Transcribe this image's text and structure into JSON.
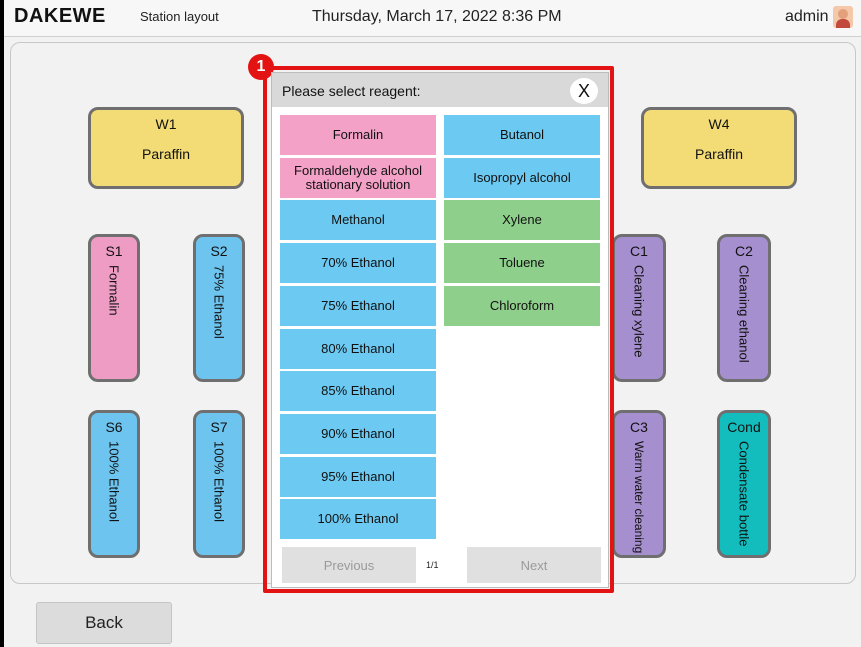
{
  "header": {
    "logo": "DAKEWE",
    "page_name": "Station layout",
    "datetime": "Thursday, March 17, 2022  8:36 PM",
    "user": "admin"
  },
  "stations": {
    "W1": {
      "id": "W1",
      "name": "Paraffin",
      "color": "#f3dc76"
    },
    "W4": {
      "id": "W4",
      "name": "Paraffin",
      "color": "#f3dc76"
    },
    "S1": {
      "id": "S1",
      "name": "Formalin",
      "color": "#ee9cc3"
    },
    "S2": {
      "id": "S2",
      "name": "75% Ethanol",
      "color": "#6cc4ef"
    },
    "C1": {
      "id": "C1",
      "name": "Cleaning xylene",
      "color": "#a68fcf"
    },
    "C2": {
      "id": "C2",
      "name": "Cleaning ethanol",
      "color": "#a68fcf"
    },
    "S6": {
      "id": "S6",
      "name": "100% Ethanol",
      "color": "#6cc4ef"
    },
    "S7": {
      "id": "S7",
      "name": "100% Ethanol",
      "color": "#6cc4ef"
    },
    "C3": {
      "id": "C3",
      "name": "Warm water cleaning",
      "color": "#a68fcf"
    },
    "Cond": {
      "id": "Cond",
      "name": "Condensate bottle",
      "color": "#13bdbd"
    }
  },
  "back_label": "Back",
  "dialog": {
    "badge": "1",
    "title": "Please select reagent:",
    "close_label": "X",
    "left_column": [
      {
        "label": "Formalin",
        "color": "#f3a1c7"
      },
      {
        "label": "Formaldehyde alcohol stationary solution",
        "color": "#f3a1c7"
      },
      {
        "label": "Methanol",
        "color": "#6cc9f1"
      },
      {
        "label": "70% Ethanol",
        "color": "#6cc9f1"
      },
      {
        "label": "75% Ethanol",
        "color": "#6cc9f1"
      },
      {
        "label": "80% Ethanol",
        "color": "#6cc9f1"
      },
      {
        "label": "85% Ethanol",
        "color": "#6cc9f1"
      },
      {
        "label": "90% Ethanol",
        "color": "#6cc9f1"
      },
      {
        "label": "95% Ethanol",
        "color": "#6cc9f1"
      },
      {
        "label": "100% Ethanol",
        "color": "#6cc9f1"
      }
    ],
    "right_column": [
      {
        "label": "Butanol",
        "color": "#6cc9f1"
      },
      {
        "label": "Isopropyl alcohol",
        "color": "#6cc9f1"
      },
      {
        "label": "Xylene",
        "color": "#8fcf8c"
      },
      {
        "label": "Toluene",
        "color": "#8fcf8c"
      },
      {
        "label": "Chloroform",
        "color": "#8fcf8c"
      }
    ],
    "previous_label": "Previous",
    "page_indicator": "1/1",
    "next_label": "Next"
  }
}
